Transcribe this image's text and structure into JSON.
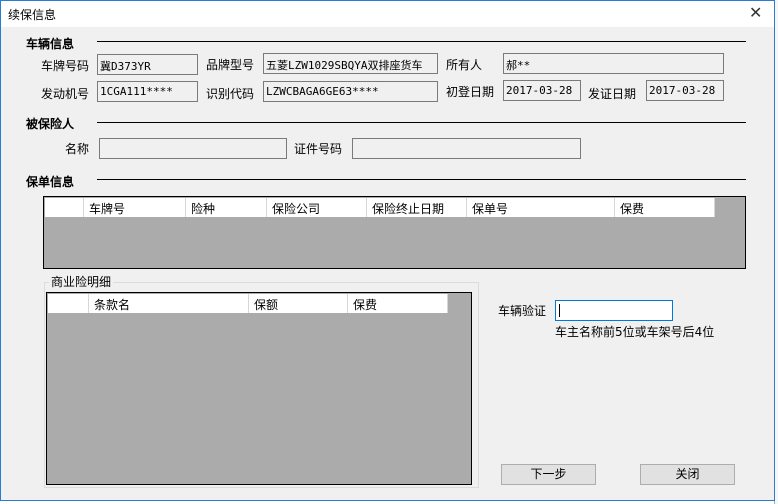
{
  "window": {
    "title": "续保信息",
    "close_icon": "close-icon"
  },
  "vehicle": {
    "section": "车辆信息",
    "plate_label": "车牌号码",
    "plate": "冀D373YR",
    "model_label": "品牌型号",
    "model": "五菱LZW1029SBQYA双排座货车",
    "owner_label": "所有人",
    "owner": "郝**",
    "engine_label": "发动机号",
    "engine": "1CGA111****",
    "vin_label": "识别代码",
    "vin": "LZWCBAGA6GE63****",
    "first_reg_label": "初登日期",
    "first_reg": "2017-03-28",
    "issue_label": "发证日期",
    "issue": "2017-03-28"
  },
  "insured": {
    "section": "被保险人",
    "name_label": "名称",
    "name": "",
    "id_label": "证件号码",
    "id": ""
  },
  "policy": {
    "section": "保单信息",
    "columns": [
      "",
      "车牌号",
      "险种",
      "保险公司",
      "保险终止日期",
      "保单号",
      "保费"
    ]
  },
  "commercial": {
    "title": "商业险明细",
    "columns": [
      "",
      "条款名",
      "保额",
      "保费"
    ]
  },
  "verify": {
    "label": "车辆验证",
    "value": "",
    "hint": "车主名称前5位或车架号后4位"
  },
  "buttons": {
    "next": "下一步",
    "close": "关闭"
  }
}
